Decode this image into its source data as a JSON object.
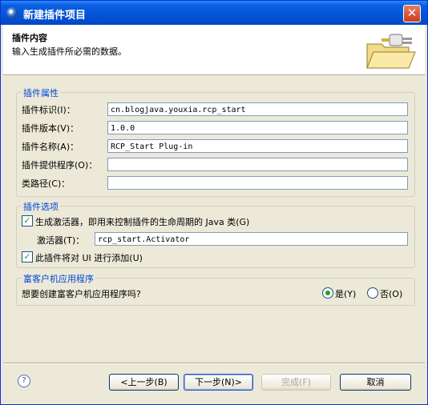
{
  "window": {
    "title": "新建插件项目"
  },
  "header": {
    "title": "插件内容",
    "description": "输入生成插件所必需的数据。"
  },
  "plugin_properties": {
    "legend": "插件属性",
    "id_label": "插件标识(I)：",
    "id_value": "cn.blogjava.youxia.rcp_start",
    "version_label": "插件版本(V)：",
    "version_value": "1.0.0",
    "name_label": "插件名称(A)：",
    "name_value": "RCP_Start Plug-in",
    "provider_label": "插件提供程序(O)：",
    "provider_value": "",
    "classpath_label": "类路径(C)：",
    "classpath_value": ""
  },
  "plugin_options": {
    "legend": "插件选项",
    "generate_activator_label": "生成激活器，即用来控制插件的生命周期的 Java 类(G)",
    "activator_label": "激活器(T)：",
    "activator_value": "rcp_start.Activator",
    "ui_contribution_label": "此插件将对 UI 进行添加(U)"
  },
  "rich_client": {
    "legend": "富客户机应用程序",
    "question": "想要创建富客户机应用程序吗?",
    "yes_label": "是(Y)",
    "no_label": "否(O)"
  },
  "buttons": {
    "help": "?",
    "back": "<上一步(B)",
    "next": "下一步(N)>",
    "finish": "完成(F)",
    "cancel": "取消"
  },
  "colors": {
    "title_bar": "#0555d8",
    "legend_text": "#0046d5",
    "dialog_bg": "#ece9d8"
  }
}
